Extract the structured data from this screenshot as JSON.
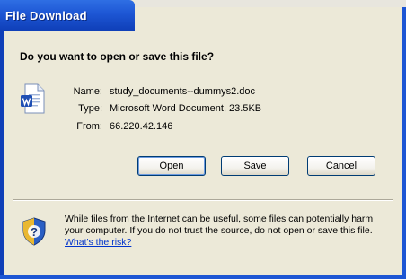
{
  "window": {
    "title": "File Download"
  },
  "dialog": {
    "question": "Do you want to open or save this file?",
    "file": {
      "icon": "word-document-icon",
      "name_label": "Name:",
      "name_value": "study_documents--dummys2.doc",
      "type_label": "Type:",
      "type_value": "Microsoft Word Document, 23.5KB",
      "from_label": "From:",
      "from_value": "66.220.42.146"
    },
    "buttons": {
      "open": "Open",
      "save": "Save",
      "cancel": "Cancel"
    },
    "warning": {
      "icon": "security-shield-icon",
      "text": "While files from the Internet can be useful, some files can potentially harm your computer. If you do not trust the source, do not open or save this file.",
      "link": "What's the risk?"
    }
  },
  "colors": {
    "titlebar": "#1d56d4",
    "dialog_bg": "#ece9d8",
    "link": "#0033cc",
    "button_border": "#003c74"
  }
}
